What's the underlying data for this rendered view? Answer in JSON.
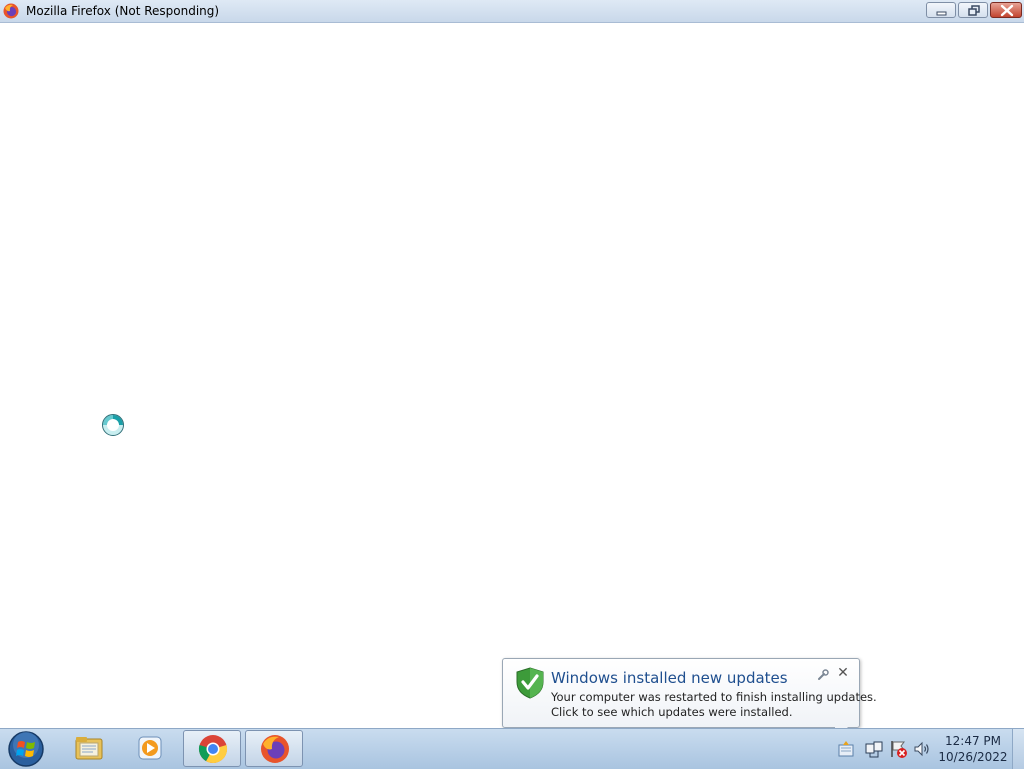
{
  "window": {
    "title": "Mozilla Firefox (Not Responding)",
    "icon": "firefox-icon",
    "controls": [
      "minimize-icon",
      "restore-icon",
      "close-icon"
    ]
  },
  "cursor": {
    "state": "busy",
    "icon": "busy-spinner-icon"
  },
  "notification": {
    "icon": "shield-check-icon",
    "title": "Windows installed new updates",
    "lines": [
      "Your computer was restarted to finish installing updates.",
      "Click to see which updates were installed."
    ],
    "close_glyph": "✕"
  },
  "taskbar": {
    "start_icon": "windows-start-icon",
    "items": [
      {
        "icon": "file-explorer-icon",
        "active": false
      },
      {
        "icon": "media-player-icon",
        "active": false
      },
      {
        "icon": "chrome-icon",
        "active": true
      },
      {
        "icon": "firefox-icon",
        "active": true
      }
    ],
    "tray_icons": [
      "windows-update-icon",
      "network-icon",
      "action-center-icon",
      "volume-icon"
    ],
    "clock": {
      "time": "12:47 PM",
      "date": "10/26/2022"
    }
  },
  "colors": {
    "notification_title": "#1f4f8f",
    "taskbar": "#a9c4e0",
    "close_button": "#c2442f"
  }
}
